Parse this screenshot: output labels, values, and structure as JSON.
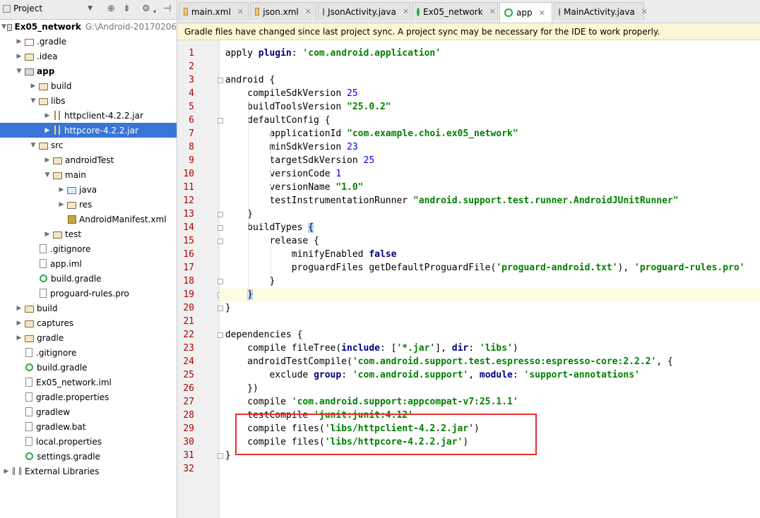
{
  "project_panel": {
    "view_label": "Project",
    "tree": [
      {
        "label": "Ex05_network",
        "path": "G:\\Android-20170206",
        "icon": "module-folder-icon",
        "bold": true,
        "arrow": "expanded"
      },
      {
        "label": ".gradle",
        "icon": "folder-excluded-icon",
        "arrow": "collapsed"
      },
      {
        "label": ".idea",
        "icon": "folder-icon",
        "arrow": "collapsed"
      },
      {
        "label": "app",
        "icon": "module-folder-icon",
        "bold": true,
        "arrow": "expanded"
      },
      {
        "label": "build",
        "icon": "folder-icon",
        "arrow": "collapsed"
      },
      {
        "label": "libs",
        "icon": "folder-icon",
        "arrow": "expanded"
      },
      {
        "label": "httpclient-4.2.2.jar",
        "icon": "jar-icon",
        "arrow": "collapsed"
      },
      {
        "label": "httpcore-4.2.2.jar",
        "icon": "jar-icon",
        "arrow": "collapsed",
        "selected": true
      },
      {
        "label": "src",
        "icon": "folder-icon",
        "arrow": "expanded"
      },
      {
        "label": "androidTest",
        "icon": "folder-icon",
        "arrow": "collapsed"
      },
      {
        "label": "main",
        "icon": "folder-icon",
        "arrow": "expanded"
      },
      {
        "label": "java",
        "icon": "source-folder-icon",
        "arrow": "collapsed"
      },
      {
        "label": "res",
        "icon": "resource-folder-icon",
        "arrow": "collapsed"
      },
      {
        "label": "AndroidManifest.xml",
        "icon": "manifest-file-icon",
        "arrow": "none"
      },
      {
        "label": "test",
        "icon": "folder-icon",
        "arrow": "collapsed"
      },
      {
        "label": ".gitignore",
        "icon": "text-file-icon",
        "arrow": "none"
      },
      {
        "label": "app.iml",
        "icon": "iml-file-icon",
        "arrow": "none"
      },
      {
        "label": "build.gradle",
        "icon": "gradle-file-icon",
        "arrow": "none"
      },
      {
        "label": "proguard-rules.pro",
        "icon": "text-file-icon",
        "arrow": "none"
      },
      {
        "label": "build",
        "icon": "folder-icon",
        "arrow": "collapsed"
      },
      {
        "label": "captures",
        "icon": "folder-icon",
        "arrow": "collapsed"
      },
      {
        "label": "gradle",
        "icon": "folder-icon",
        "arrow": "collapsed"
      },
      {
        "label": ".gitignore",
        "icon": "text-file-icon",
        "arrow": "none"
      },
      {
        "label": "build.gradle",
        "icon": "gradle-file-icon",
        "arrow": "none"
      },
      {
        "label": "Ex05_network.iml",
        "icon": "iml-file-icon",
        "arrow": "none"
      },
      {
        "label": "gradle.properties",
        "icon": "properties-file-icon",
        "arrow": "none"
      },
      {
        "label": "gradlew",
        "icon": "text-file-icon",
        "arrow": "none"
      },
      {
        "label": "gradlew.bat",
        "icon": "text-file-icon",
        "arrow": "none"
      },
      {
        "label": "local.properties",
        "icon": "properties-file-icon",
        "arrow": "none"
      },
      {
        "label": "settings.gradle",
        "icon": "gradle-file-icon",
        "arrow": "none"
      },
      {
        "label": "External Libraries",
        "icon": "external-libraries-icon",
        "arrow": "collapsed"
      }
    ]
  },
  "tabs": [
    {
      "label": "main.xml",
      "icon": "xml-file-icon",
      "active": false
    },
    {
      "label": "json.xml",
      "icon": "xml-file-icon",
      "active": false
    },
    {
      "label": "JsonActivity.java",
      "icon": "java-class-icon",
      "active": false
    },
    {
      "label": "Ex05_network",
      "icon": "gradle-file-icon",
      "active": false
    },
    {
      "label": "app",
      "icon": "gradle-file-icon",
      "active": true
    },
    {
      "label": "MainActivity.java",
      "icon": "java-class-icon",
      "active": false
    }
  ],
  "banner": {
    "message": "Gradle files have changed since last project sync. A project sync may be necessary for the IDE to work properly."
  },
  "editor": {
    "current_line": 19,
    "highlighted_lines": [
      29,
      30,
      31
    ],
    "lines": [
      "apply plugin: 'com.android.application'",
      "",
      "android {",
      "    compileSdkVersion 25",
      "    buildToolsVersion \"25.0.2\"",
      "    defaultConfig {",
      "        applicationId \"com.example.choi.ex05_network\"",
      "        minSdkVersion 23",
      "        targetSdkVersion 25",
      "        versionCode 1",
      "        versionName \"1.0\"",
      "        testInstrumentationRunner \"android.support.test.runner.AndroidJUnitRunner\"",
      "    }",
      "    buildTypes {",
      "        release {",
      "            minifyEnabled false",
      "            proguardFiles getDefaultProguardFile('proguard-android.txt'), 'proguard-rules.pro'",
      "        }",
      "    }",
      "}",
      "",
      "dependencies {",
      "    compile fileTree(include: ['*.jar'], dir: 'libs')",
      "    androidTestCompile('com.android.support.test.espresso:espresso-core:2.2.2', {",
      "        exclude group: 'com.android.support', module: 'support-annotations'",
      "    })",
      "    compile 'com.android.support:appcompat-v7:25.1.1'",
      "    testCompile 'junit:junit:4.12'",
      "    compile files('libs/httpclient-4.2.2.jar')",
      "    compile files('libs/httpcore-4.2.2.jar')",
      "}",
      ""
    ]
  },
  "colors": {
    "selection": "#3875d7",
    "line_number": "#b30000",
    "string": "#008000",
    "keyword": "#000080",
    "number": "#0000ff",
    "annotation_box": "#e53030",
    "banner_bg": "#fbf7d4"
  }
}
